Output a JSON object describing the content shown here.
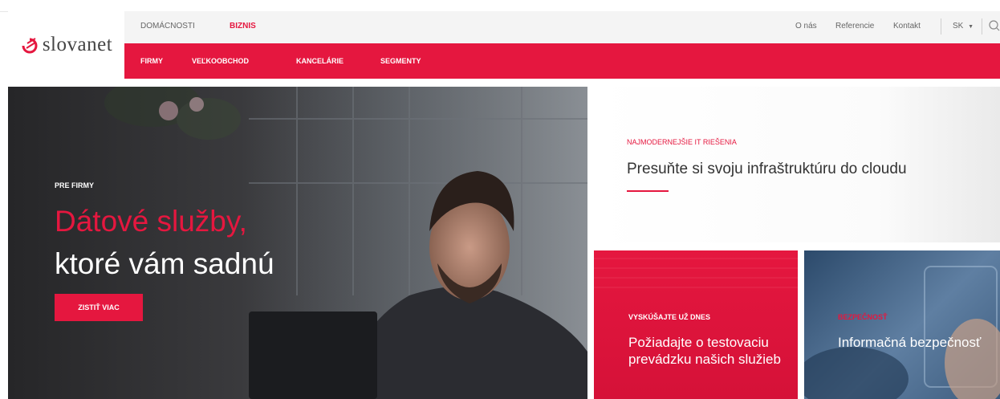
{
  "header": {
    "logo_text": "slovanet",
    "segments": [
      "DOMÁCNOSTI",
      "BIZNIS"
    ],
    "top_links": [
      "O nás",
      "Referencie",
      "Kontakt"
    ],
    "language": "SK",
    "main_nav": [
      "FIRMY",
      "VEĽKOOBCHOD",
      "KANCELÁRIE",
      "SEGMENTY"
    ]
  },
  "hero": {
    "pre_title": "PRE FIRMY",
    "title_line1": "Dátové služby,",
    "title_line2": "ktoré vám sadnú",
    "cta_label": "ZISTIŤ VIAC"
  },
  "cards": [
    {
      "pre_title": "NAJMODERNEJŠIE IT RIEŠENIA",
      "title": "Presuňte si svoju infraštruktúru do cloudu"
    },
    {
      "pre_title": "VYSKÚŠAJTE UŽ DNES",
      "title": "Požiadajte o testovaciu prevádzku našich služieb"
    },
    {
      "pre_title": "BEZPEČNOSŤ",
      "title": "Informačná bezpečnosť"
    }
  ],
  "icons": {
    "logo": "slovanet-logo-icon",
    "search": "search-icon",
    "dropdown": "chevron-down-icon"
  },
  "colors": {
    "accent": "#e5173f"
  }
}
